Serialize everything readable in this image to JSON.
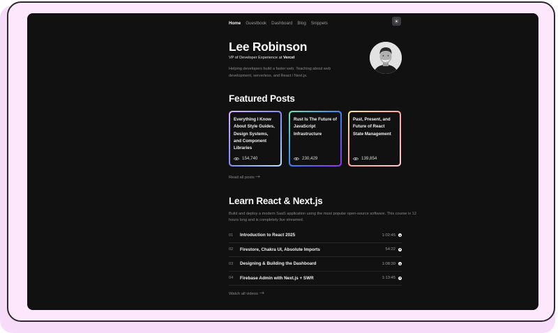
{
  "nav": {
    "items": [
      {
        "label": "Home",
        "active": true
      },
      {
        "label": "Guestbook",
        "active": false
      },
      {
        "label": "Dashboard",
        "active": false
      },
      {
        "label": "Blog",
        "active": false
      },
      {
        "label": "Snippets",
        "active": false
      }
    ],
    "theme_toggle_icon": "sun-icon"
  },
  "hero": {
    "name": "Lee Robinson",
    "role_prefix": "VP of Developer Experience at ",
    "role_company": "Vercel",
    "bio": "Helping developers build a faster web. Teaching about web development, serverless, and React / Next.js."
  },
  "featured": {
    "heading": "Featured Posts",
    "posts": [
      {
        "title": "Everything I Know About Style Guides, Design Systems, and Component Libraries",
        "views": "154,740",
        "gradient": [
          "#d8b4fe",
          "#818cf8",
          "#b4e3ff"
        ]
      },
      {
        "title": "Rust Is The Future of JavaScript Infrastructure",
        "views": "230,429",
        "gradient": [
          "#6ee7b7",
          "#3b82f6",
          "#9333ea"
        ]
      },
      {
        "title": "Past, Present, and Future of React State Management",
        "views": "139,854",
        "gradient": [
          "#fde68a",
          "#fca5a5",
          "#fecaca"
        ]
      }
    ],
    "read_all": "Read all posts"
  },
  "course": {
    "heading": "Learn React & Next.js",
    "description": "Build and deploy a modern SaaS application using the most popular open-source software. This course is 12 hours long and is completely live streamed.",
    "lessons": [
      {
        "num": "01",
        "title": "Introduction to React 2025",
        "time": "1:02:45"
      },
      {
        "num": "02",
        "title": "Firestore, Chakra UI, Absolute Imports",
        "time": "54:22"
      },
      {
        "num": "03",
        "title": "Designing & Building the Dashboard",
        "time": "1:08:30"
      },
      {
        "num": "04",
        "title": "Firebase Admin with Next.js + SWR",
        "time": "1:13:45"
      }
    ],
    "watch_all": "Watch all videos"
  },
  "colors": {
    "frame_bg": "#fde7fd",
    "screen_bg": "#111111",
    "accent_text": "#fafafa",
    "muted_text": "#8a8a8a"
  }
}
